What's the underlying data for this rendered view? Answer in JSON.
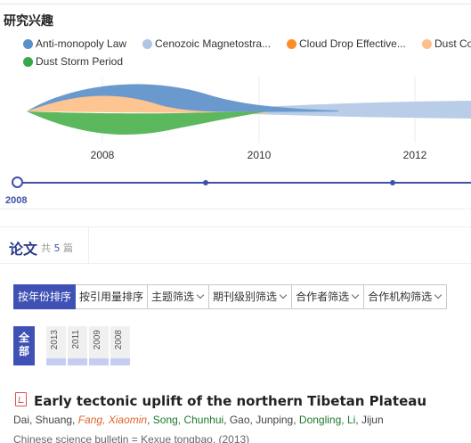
{
  "section": {
    "title": "研究兴趣"
  },
  "legend": [
    {
      "label": "Anti-monopoly Law",
      "color": "#5b8fc7"
    },
    {
      "label": "Cenozoic Magnetostra...",
      "color": "#b0c6e4"
    },
    {
      "label": "Cloud Drop Effective...",
      "color": "#ff8c2a"
    },
    {
      "label": "Dust Co",
      "color": "#fcc08a"
    },
    {
      "label": "Dust Storm Period",
      "color": "#38a84a"
    }
  ],
  "chart_data": {
    "type": "area",
    "stream": true,
    "x_ticks": [
      "2008",
      "2010",
      "2012"
    ]
  },
  "timeline": {
    "selected_year": "2008"
  },
  "papers": {
    "title": "论文",
    "count_prefix": "共",
    "count": "5",
    "count_suffix": "篇"
  },
  "tabs": [
    {
      "label": "按年份排序",
      "active": true,
      "dropdown": false
    },
    {
      "label": "按引用量排序",
      "active": false,
      "dropdown": false
    },
    {
      "label": "主题筛选",
      "active": false,
      "dropdown": true
    },
    {
      "label": "期刊级别筛选",
      "active": false,
      "dropdown": true
    },
    {
      "label": "合作者筛选",
      "active": false,
      "dropdown": true
    },
    {
      "label": "合作机构筛选",
      "active": false,
      "dropdown": true
    }
  ],
  "year_filter": {
    "all_label": "全部",
    "years": [
      "2013",
      "2011",
      "2009",
      "2008"
    ]
  },
  "paper": {
    "title": "Early tectonic uplift of the northern Tibetan Plateau",
    "authors": [
      {
        "name": "Dai, Shuang",
        "style": "plain"
      },
      {
        "name": "Fang, Xiaomin",
        "style": "highlight"
      },
      {
        "name": "Song, Chunhui",
        "style": "link"
      },
      {
        "name": "Gao, Junping",
        "style": "plain"
      },
      {
        "name": "Dongling, Li",
        "style": "link"
      },
      {
        "name": "Jijun",
        "style": "plain"
      }
    ],
    "journal": "Chinese science bulletin = Kexue tongbao. (2013)"
  }
}
